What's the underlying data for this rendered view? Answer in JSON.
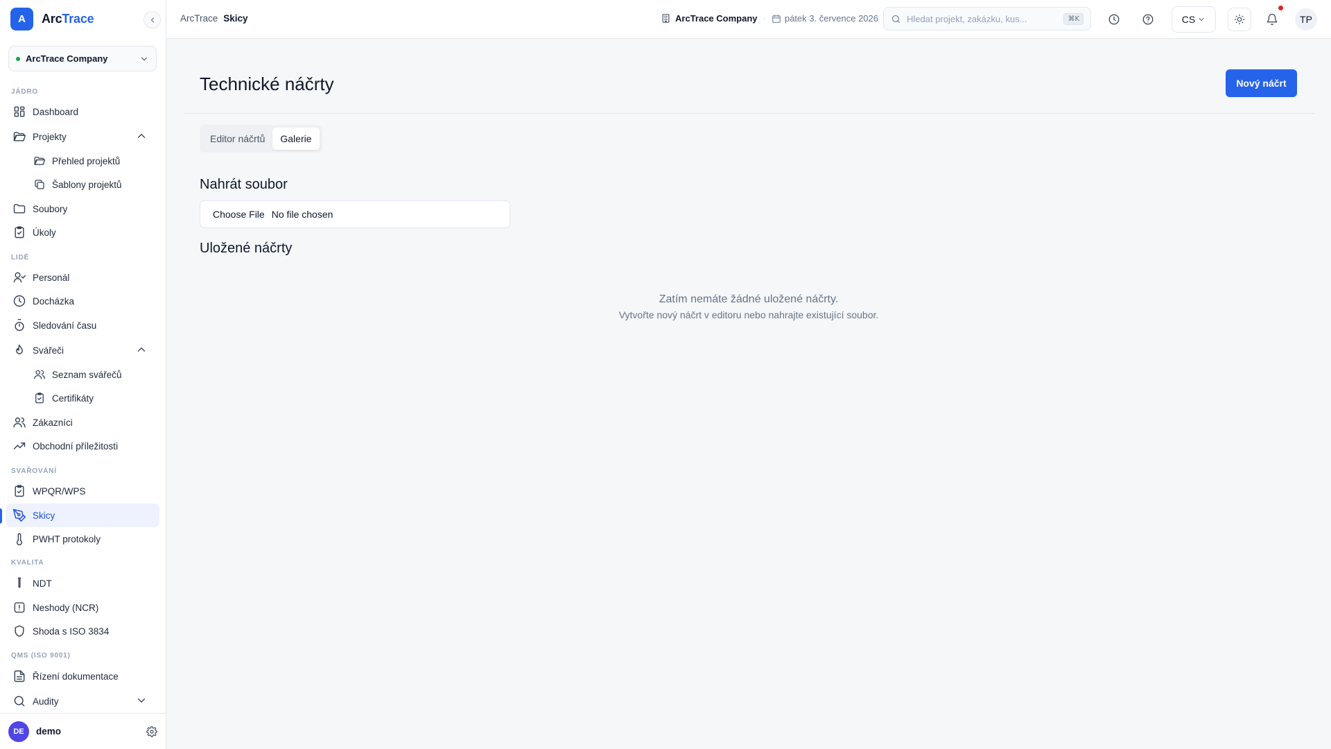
{
  "brand": {
    "logo_letter": "A",
    "name_part1": "Arc",
    "name_part2": "Trace"
  },
  "company_select": {
    "value": "ArcTrace Company"
  },
  "sidebar": {
    "sections": {
      "core": "JÁDRO",
      "people": "LIDÉ",
      "welding": "SVAŘOVÁNÍ",
      "quality": "KVALITA",
      "qms": "QMS (ISO 9001)"
    },
    "items": {
      "dashboard": "Dashboard",
      "projects": "Projekty",
      "projects_overview": "Přehled projektů",
      "project_templates": "Šablony projektů",
      "files": "Soubory",
      "tasks": "Úkoly",
      "staff": "Personál",
      "attendance": "Docházka",
      "time_tracking": "Sledování času",
      "welders": "Svářeči",
      "welders_list": "Seznam svářečů",
      "certificates": "Certifikáty",
      "customers": "Zákazníci",
      "opportunities": "Obchodní příležitosti",
      "wpqr": "WPQR/WPS",
      "sketches": "Skicy",
      "pwht": "PWHT protokoly",
      "ndt": "NDT",
      "ncr": "Neshody (NCR)",
      "iso3834": "Shoda s ISO 3834",
      "doc_control": "Řízení dokumentace",
      "audits": "Audity"
    },
    "active_item": "sketches",
    "footer": {
      "avatar_initials": "DE",
      "username": "demo"
    }
  },
  "topbar": {
    "breadcrumb": [
      "ArcTrace",
      "Skicy"
    ],
    "company": "ArcTrace Company",
    "date": "pátek 3. července 2026",
    "search": {
      "placeholder": "Hledat projekt, zakázku, kus...",
      "shortcut": "⌘K"
    },
    "language": "CS",
    "notifications_unread": true,
    "user_initials": "TP"
  },
  "page": {
    "title": "Technické náčrty",
    "new_button": "Nový náčrt",
    "tabs": [
      {
        "label": "Editor náčrtů",
        "active": false
      },
      {
        "label": "Galerie",
        "active": true
      }
    ],
    "upload_title": "Nahrát soubor",
    "file_input": {
      "button": "Choose File",
      "status": "No file chosen"
    },
    "saved_title": "Uložené náčrty",
    "empty_title": "Zatím nemáte žádné uložené náčrty.",
    "empty_subtitle": "Vytvořte nový náčrt v editoru nebo nahrajte existující soubor."
  },
  "colors": {
    "accent": "#2563eb",
    "notification": "#dc2626",
    "status_online": "#16a34a",
    "avatar": "#4f46e5"
  }
}
